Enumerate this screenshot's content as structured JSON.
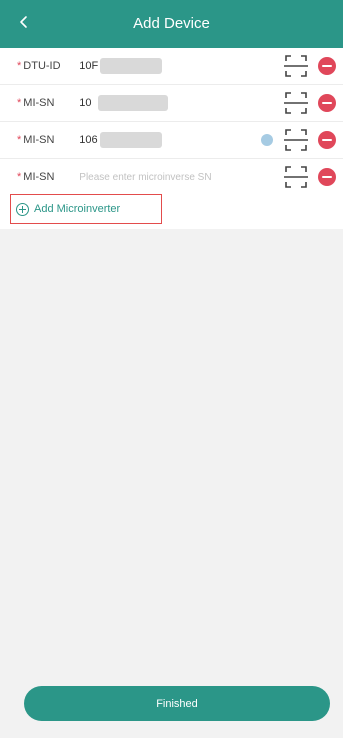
{
  "header": {
    "title": "Add Device",
    "back_icon": "chevron-left-icon"
  },
  "rows": [
    {
      "required_mark": "*",
      "label": "DTU-ID",
      "value": "10F",
      "value_blurred": true,
      "placeholder": ""
    },
    {
      "required_mark": "*",
      "label": "MI-SN",
      "value": "10",
      "value_blurred": true,
      "placeholder": ""
    },
    {
      "required_mark": "*",
      "label": "MI-SN",
      "value": "106",
      "value_blurred": true,
      "placeholder": ""
    },
    {
      "required_mark": "*",
      "label": "MI-SN",
      "value": "",
      "value_blurred": false,
      "placeholder": "Please enter microinverse SN"
    }
  ],
  "add_microinverter": {
    "label": "Add Microinverter",
    "icon": "plus-circle-icon"
  },
  "footer": {
    "finished_label": "Finished"
  },
  "icons": {
    "scan": "scan-icon",
    "remove": "remove-icon"
  },
  "colors": {
    "accent": "#2b9688",
    "danger": "#e0475a",
    "highlight_border": "#e34c4c",
    "background": "#f2f2f2"
  }
}
